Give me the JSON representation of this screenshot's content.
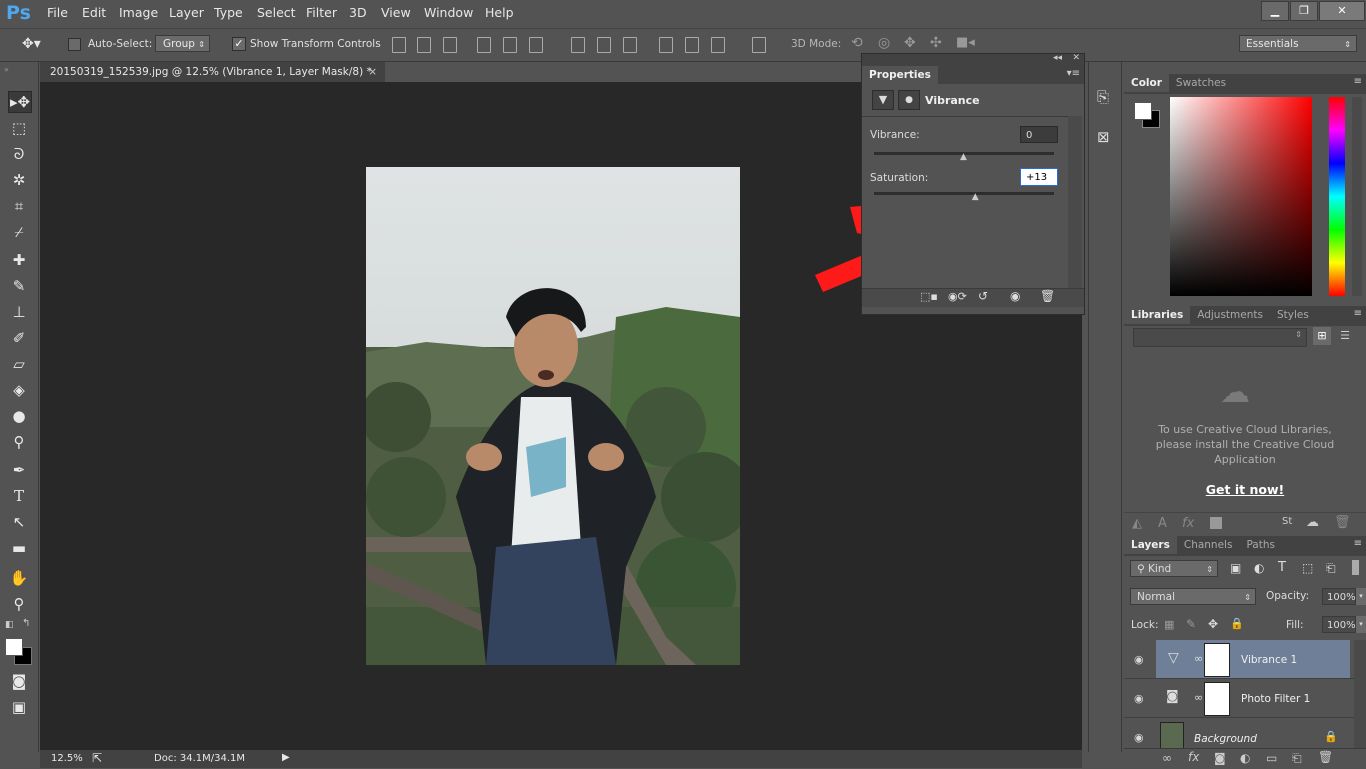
{
  "app": {
    "logo": "Ps"
  },
  "menu": [
    "File",
    "Edit",
    "Image",
    "Layer",
    "Type",
    "Select",
    "Filter",
    "3D",
    "View",
    "Window",
    "Help"
  ],
  "window_controls": {
    "minimize": "▁",
    "maximize": "❐",
    "close": "✕"
  },
  "options_bar": {
    "auto_select_label": "Auto-Select:",
    "auto_select_checked": false,
    "group_value": "Group",
    "show_transform_label": "Show Transform Controls",
    "show_transform_checked": true,
    "mode_3d_label": "3D Mode:",
    "workspace": "Essentials"
  },
  "document": {
    "tab_title": "20150319_152539.jpg @ 12.5% (Vibrance 1, Layer Mask/8) *",
    "close": "×",
    "zoom": "12.5%",
    "doc_size": "Doc: 34.1M/34.1M"
  },
  "properties": {
    "tab": "Properties",
    "adjustment_title": "Vibrance",
    "vibrance_label": "Vibrance:",
    "vibrance_value": "0",
    "vibrance_slider": 0.5,
    "saturation_label": "Saturation:",
    "saturation_value": "+13",
    "saturation_slider": 0.565
  },
  "color_panel": {
    "tabs": [
      "Color",
      "Swatches"
    ],
    "foreground": "#ffffff",
    "background": "#000000",
    "hue_color": "#ff0000"
  },
  "libraries_panel": {
    "tabs": [
      "Libraries",
      "Adjustments",
      "Styles"
    ],
    "message": "To use Creative Cloud Libraries, please install the Creative Cloud Application",
    "cta": "Get it now!"
  },
  "layers_panel": {
    "tabs": [
      "Layers",
      "Channels",
      "Paths"
    ],
    "filter_kind": "Kind",
    "blend_mode": "Normal",
    "opacity_label": "Opacity:",
    "opacity_value": "100%",
    "lock_label": "Lock:",
    "fill_label": "Fill:",
    "fill_value": "100%",
    "layers": [
      {
        "name": "Vibrance 1",
        "selected": true
      },
      {
        "name": "Photo Filter 1",
        "selected": false
      },
      {
        "name": "Background",
        "selected": false
      }
    ]
  },
  "colors": {
    "app_bg": "#535353",
    "canvas_bg": "#282828",
    "selected_layer": "#6e7f97",
    "arrow_red": "#ff1a1a",
    "logo_blue": "#4ea8f0"
  }
}
